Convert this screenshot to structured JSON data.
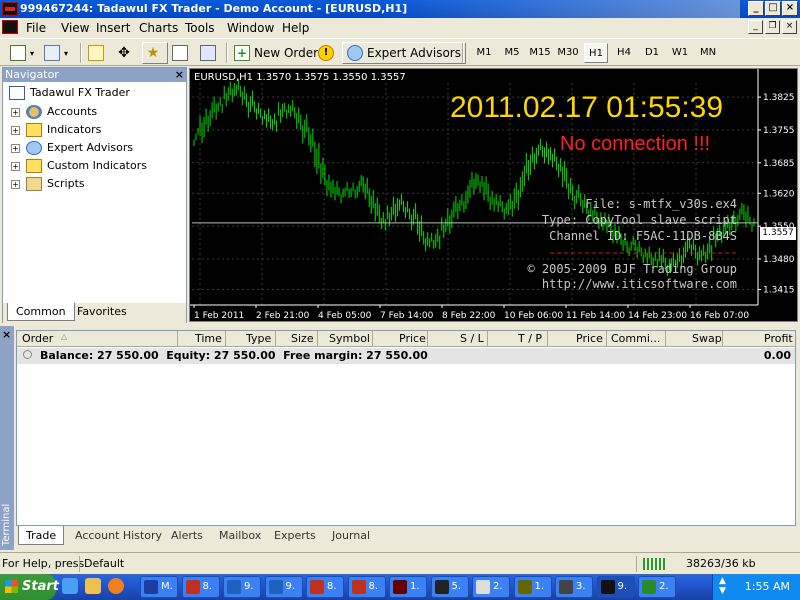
{
  "window": {
    "title": "999467244: Tadawul FX Trader - Demo Account - [EURUSD,H1]"
  },
  "menu": [
    "File",
    "View",
    "Insert",
    "Charts",
    "Tools",
    "Window",
    "Help"
  ],
  "toolbar": {
    "new_order": "New Order",
    "expert_advisors": "Expert Advisors",
    "timeframes": [
      "M1",
      "M5",
      "M15",
      "M30",
      "H1",
      "H4",
      "D1",
      "W1",
      "MN"
    ],
    "selected_timeframe": "H1"
  },
  "navigator": {
    "title": "Navigator",
    "root": "Tadawul FX Trader",
    "items": [
      "Accounts",
      "Indicators",
      "Expert Advisors",
      "Custom Indicators",
      "Scripts"
    ],
    "tabs": [
      "Common",
      "Favorites"
    ]
  },
  "chart": {
    "symbol_header": "EURUSD,H1  1.3570 1.3575 1.3550 1.3557",
    "clock": "2011.02.17 01:55:39",
    "status": "No connection !!!",
    "info_lines": [
      "File: s-mtfx_v30s.ex4",
      "Type: CopyTool slave script",
      "Channel ID: F5AC-11DB-8B4S",
      "© 2005-2009 BJF Trading Group",
      "http://www.iticsoftware.com"
    ],
    "current_price": "1.3557"
  },
  "chart_data": {
    "type": "bar",
    "title": "EURUSD,H1",
    "xlabel": "",
    "ylabel": "",
    "ylim": [
      1.3382,
      1.3855
    ],
    "y_ticks": [
      "1.3825",
      "1.3755",
      "1.3685",
      "1.3620",
      "1.3550",
      "1.3480",
      "1.3415"
    ],
    "x_ticks": [
      "1 Feb 2011",
      "2 Feb 21:00",
      "4 Feb 05:00",
      "7 Feb 14:00",
      "8 Feb 22:00",
      "10 Feb 06:00",
      "11 Feb 14:00",
      "14 Feb 23:00",
      "16 Feb 07:00"
    ],
    "close_series": [
      1.374,
      1.377,
      1.379,
      1.381,
      1.3815,
      1.383,
      1.3845,
      1.3835,
      1.382,
      1.38,
      1.379,
      1.3785,
      1.377,
      1.378,
      1.3795,
      1.38,
      1.379,
      1.377,
      1.3745,
      1.372,
      1.368,
      1.365,
      1.363,
      1.3615,
      1.362,
      1.3625,
      1.363,
      1.364,
      1.362,
      1.3595,
      1.357,
      1.356,
      1.3575,
      1.36,
      1.359,
      1.358,
      1.356,
      1.353,
      1.3515,
      1.352,
      1.3535,
      1.355,
      1.3575,
      1.3595,
      1.3605,
      1.363,
      1.365,
      1.364,
      1.3615,
      1.36,
      1.359,
      1.358,
      1.36,
      1.363,
      1.366,
      1.369,
      1.371,
      1.372,
      1.37,
      1.3685,
      1.367,
      1.364,
      1.362,
      1.3605,
      1.359,
      1.358,
      1.357,
      1.356,
      1.3545,
      1.353,
      1.352,
      1.351,
      1.3505,
      1.3495,
      1.349,
      1.348,
      1.3485,
      1.347,
      1.346,
      1.3475,
      1.349,
      1.351,
      1.35,
      1.3485,
      1.3495,
      1.3515,
      1.353,
      1.354,
      1.3555,
      1.357,
      1.358,
      1.356,
      1.3557
    ],
    "current_price": 1.3557
  },
  "terminal": {
    "title": "Terminal",
    "columns": [
      "Order",
      "Time",
      "Type",
      "Size",
      "Symbol",
      "Price",
      "S / L",
      "T / P",
      "Price",
      "Commi...",
      "Swap",
      "Profit"
    ],
    "balance_text": "Balance: 27 550.00  Equity: 27 550.00  Free margin: 27 550.00",
    "profit": "0.00",
    "tabs": [
      "Trade",
      "Account History",
      "Alerts",
      "Mailbox",
      "Experts",
      "Journal"
    ]
  },
  "status": {
    "help": "For Help, press",
    "profile": "Default",
    "traffic": "38263/36 kb"
  },
  "taskbar": {
    "start": "Start",
    "tasks": [
      "M.",
      "8.",
      "9.",
      "9.",
      "8.",
      "8.",
      "1.",
      "5.",
      "2.",
      "1.",
      "3.",
      "9.",
      "2."
    ],
    "clock": "1:55 AM"
  }
}
